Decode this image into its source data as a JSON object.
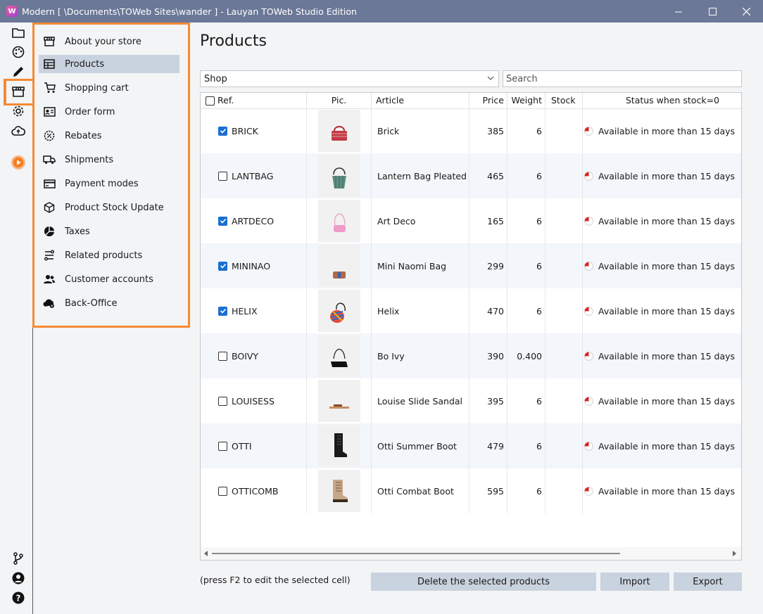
{
  "window": {
    "title": "Modern [ \\Documents\\TOWeb Sites\\wander ] - Lauyan TOWeb Studio Edition",
    "app_icon_letter": "W"
  },
  "rail": {
    "top": [
      "folder-icon",
      "palette-icon",
      "pencil-icon",
      "store-icon",
      "gear-icon",
      "cloud-upload-icon",
      "play-icon"
    ],
    "bottom": [
      "branch-icon",
      "account-icon",
      "help-icon"
    ]
  },
  "menu": {
    "items": [
      {
        "label": "About your store",
        "icon": "storefront-icon"
      },
      {
        "label": "Products",
        "icon": "table-icon",
        "active": true
      },
      {
        "label": "Shopping cart",
        "icon": "cart-icon"
      },
      {
        "label": "Order form",
        "icon": "id-card-icon"
      },
      {
        "label": "Rebates",
        "icon": "discount-icon"
      },
      {
        "label": "Shipments",
        "icon": "truck-icon"
      },
      {
        "label": "Payment modes",
        "icon": "credit-card-icon"
      },
      {
        "label": "Product Stock Update",
        "icon": "box-icon"
      },
      {
        "label": "Taxes",
        "icon": "pie-icon"
      },
      {
        "label": "Related products",
        "icon": "related-icon"
      },
      {
        "label": "Customer accounts",
        "icon": "users-icon"
      },
      {
        "label": "Back-Office",
        "icon": "cloud-gear-icon"
      }
    ]
  },
  "main": {
    "title": "Products",
    "shop_select": "Shop",
    "search_placeholder": "Search",
    "columns": {
      "ref": "Ref.",
      "pic": "Pic.",
      "article": "Article",
      "price": "Price",
      "weight": "Weight",
      "stock": "Stock",
      "status": "Status when stock=0"
    },
    "rows": [
      {
        "ref": "BRICK",
        "checked": true,
        "article": "Brick",
        "price": "385",
        "weight": "6",
        "stock": "",
        "status": "Available in more than 15 days",
        "pic": "bag-red"
      },
      {
        "ref": "LANTBAG",
        "checked": false,
        "article": "Lantern Bag Pleated",
        "price": "465",
        "weight": "6",
        "stock": "",
        "status": "Available in more than 15 days",
        "pic": "bag-green"
      },
      {
        "ref": "ARTDECO",
        "checked": true,
        "article": "Art Deco",
        "price": "165",
        "weight": "6",
        "stock": "",
        "status": "Available in more than 15 days",
        "pic": "bag-pink"
      },
      {
        "ref": "MININAO",
        "checked": true,
        "article": "Mini Naomi Bag",
        "price": "299",
        "weight": "6",
        "stock": "",
        "status": "Available in more than 15 days",
        "pic": "bag-mini"
      },
      {
        "ref": "HELIX",
        "checked": true,
        "article": "Helix",
        "price": "470",
        "weight": "6",
        "stock": "",
        "status": "Available in more than 15 days",
        "pic": "bag-helix"
      },
      {
        "ref": "BOIVY",
        "checked": false,
        "article": "Bo Ivy",
        "price": "390",
        "weight": "0.400",
        "stock": "",
        "status": "Available in more than 15 days",
        "pic": "bag-black"
      },
      {
        "ref": "LOUISESS",
        "checked": false,
        "article": "Louise Slide Sandal",
        "price": "395",
        "weight": "6",
        "stock": "",
        "status": "Available in more than 15 days",
        "pic": "sandal"
      },
      {
        "ref": "OTTI",
        "checked": false,
        "article": "Otti Summer Boot",
        "price": "479",
        "weight": "6",
        "stock": "",
        "status": "Available in more than 15 days",
        "pic": "boot-black"
      },
      {
        "ref": "OTTICOMB",
        "checked": false,
        "article": "Otti Combat Boot",
        "price": "595",
        "weight": "6",
        "stock": "",
        "status": "Available in more than 15 days",
        "pic": "boot-tan"
      }
    ],
    "hint": "(press F2 to edit the selected cell)",
    "buttons": {
      "delete": "Delete the selected products",
      "import": "Import",
      "export": "Export"
    }
  },
  "colors": {
    "accent_orange": "#f58a33",
    "titlebar": "#6b7897",
    "active_item": "#c9d3df",
    "check_blue": "#1a6fd1"
  }
}
